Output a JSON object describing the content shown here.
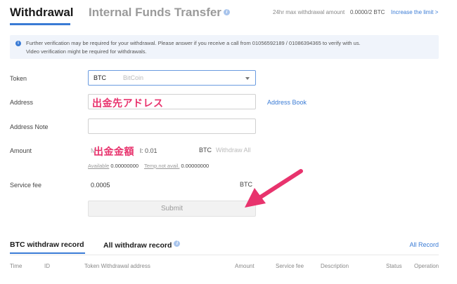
{
  "header": {
    "tab_withdrawal": "Withdrawal",
    "tab_internal_transfer": "Internal Funds Transfer",
    "limit_label": "24hr max withdrawal amount",
    "limit_value": "0.0000/2 BTC",
    "increase_limit": "Increase the limit >"
  },
  "notice": {
    "line1": "Further verification may be required for your withdrawal. Please answer if you receive a call from 01056592189 / 01086394365 to verify with us.",
    "line2": "Video verification might be required for withdrawals."
  },
  "form": {
    "token_label": "Token",
    "token_code": "BTC",
    "token_name": "BitCoin",
    "address_label": "Address",
    "address_overlay": "出金先アドレス",
    "address_book": "Address Book",
    "address_note_label": "Address Note",
    "amount_label": "Amount",
    "amount_prefix": "M",
    "amount_hint": "l: 0.01",
    "amount_overlay": "出金金額",
    "amount_unit": "BTC",
    "withdraw_all": "Withdraw All",
    "available_label": "Available",
    "available_value": "0.00000000",
    "temp_label": "Temp.not avail.",
    "temp_value": "0.00000000",
    "service_fee_label": "Service fee",
    "service_fee_value": "0.0005",
    "service_fee_unit": "BTC",
    "submit_label": "Submit"
  },
  "records": {
    "tab_btc": "BTC withdraw record",
    "tab_all": "All withdraw record",
    "all_record_link": "All Record",
    "columns": [
      "Time",
      "ID",
      "Token Withdrawal address",
      "Amount",
      "Service fee",
      "Description",
      "Status",
      "Operation"
    ]
  },
  "colors": {
    "accent": "#3a7bd5",
    "annotation": "#e8336d",
    "notice_bg": "#f0f4fb"
  }
}
